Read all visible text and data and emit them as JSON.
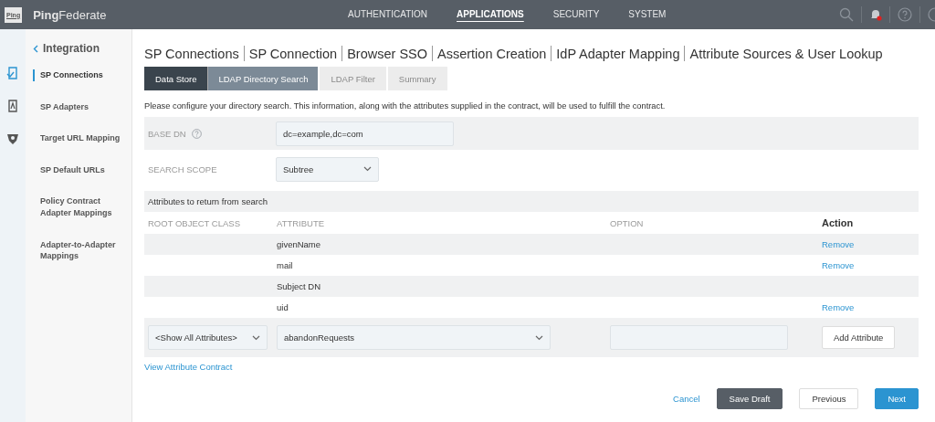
{
  "header": {
    "logo_badge": "Ping",
    "brand_bold": "Ping",
    "brand_rest": "Federate",
    "nav": [
      {
        "label": "AUTHENTICATION",
        "selected": false
      },
      {
        "label": "APPLICATIONS",
        "selected": true
      },
      {
        "label": "SECURITY",
        "selected": false
      },
      {
        "label": "SYSTEM",
        "selected": false
      }
    ],
    "notifications": true
  },
  "rail": [
    {
      "selected": true
    },
    {
      "selected": false
    },
    {
      "selected": false
    }
  ],
  "sidebar": {
    "back": "Integration",
    "items": [
      {
        "label": "SP Connections",
        "selected": true
      },
      {
        "label": "SP Adapters",
        "selected": false
      },
      {
        "label": "Target URL Mapping",
        "selected": false
      },
      {
        "label": "SP Default URLs",
        "selected": false
      },
      {
        "label": "Policy Contract Adapter Mappings",
        "selected": false
      },
      {
        "label": "Adapter-to-Adapter Mappings",
        "selected": false
      }
    ]
  },
  "breadcrumb": [
    "SP Connections",
    "SP Connection",
    "Browser SSO",
    "Assertion Creation",
    "IdP Adapter Mapping",
    "Attribute Sources & User Lookup"
  ],
  "steps": [
    {
      "label": "Data Store",
      "selected": false,
      "disabled": false
    },
    {
      "label": "LDAP Directory Search",
      "selected": true,
      "disabled": false
    },
    {
      "label": "LDAP Filter",
      "selected": false,
      "disabled": true
    },
    {
      "label": "Summary",
      "selected": false,
      "disabled": true
    }
  ],
  "description": "Please configure your directory search. This information, along with the attributes supplied in the contract, will be used to fulfill the contract.",
  "base_dn": {
    "label": "BASE DN",
    "value": "dc=example,dc=com"
  },
  "search_scope": {
    "label": "SEARCH SCOPE",
    "value": "Subtree"
  },
  "attributes": {
    "title": "Attributes to return from search",
    "columns": [
      "ROOT OBJECT CLASS",
      "ATTRIBUTE",
      "OPTION",
      "Action"
    ],
    "rows": [
      {
        "attribute": "givenName",
        "action": "Remove"
      },
      {
        "attribute": "mail",
        "action": "Remove"
      },
      {
        "attribute": "Subject DN"
      },
      {
        "attribute": "uid",
        "action": "Remove"
      }
    ],
    "new_row": {
      "object_class": "<Show All Attributes>",
      "attribute": "abandonRequests",
      "button": "Add Attribute"
    }
  },
  "link": "View Attribute Contract",
  "footer": {
    "cancel": "Cancel",
    "save": "Save Draft",
    "previous": "Previous",
    "next": "Next"
  }
}
